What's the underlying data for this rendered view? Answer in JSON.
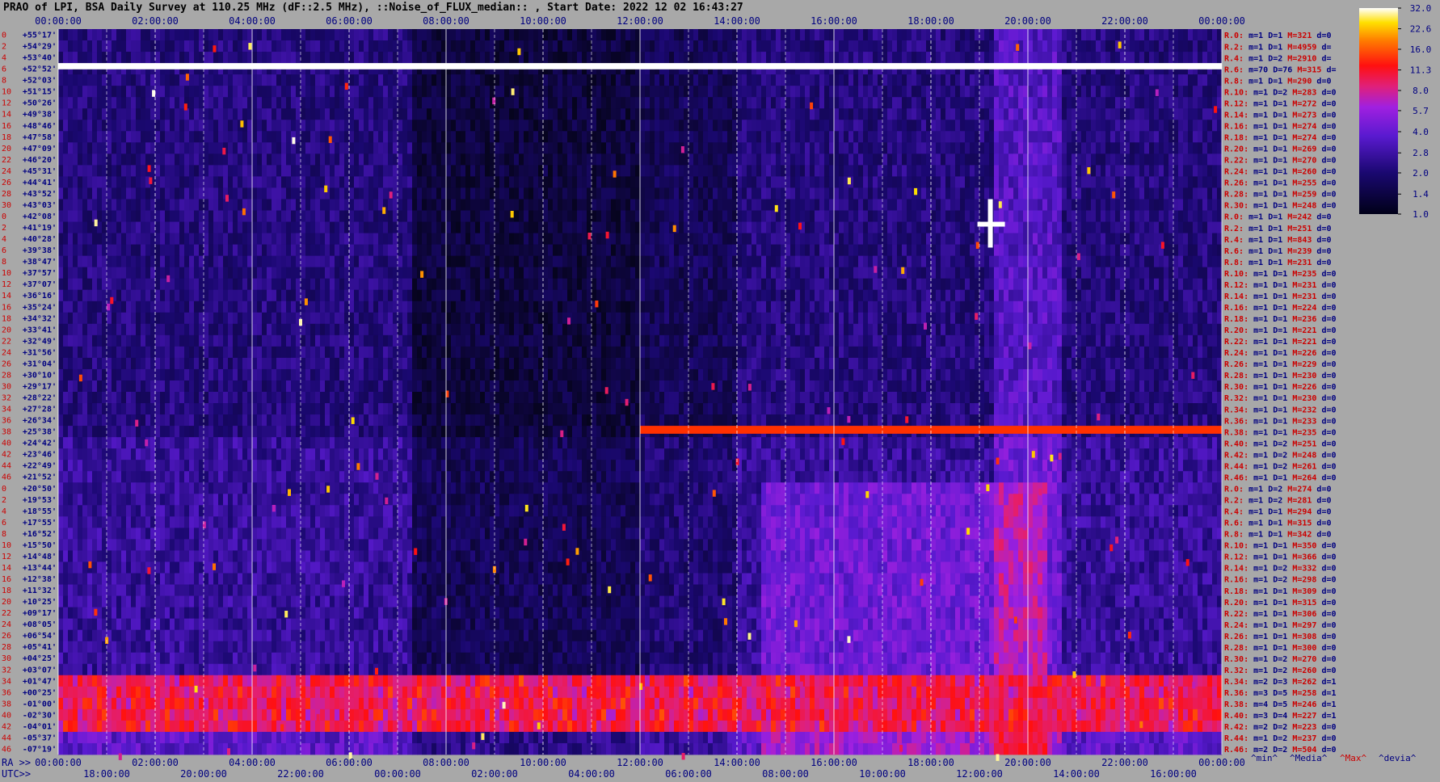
{
  "title": "PRAO of LPI, BSA Daily Survey at 110.25 MHz (dF::2.5 MHz), ::Noise_of_FLUX_median:: , Start Date: 2022 12 02 16:43:27",
  "chart_data": {
    "type": "heatmap",
    "title": "PRAO of LPI, BSA Daily Survey at 110.25 MHz (dF::2.5 MHz), ::Noise_of_FLUX_median:: , Start Date: 2022 12 02 16:43:27",
    "top_time_ticks": [
      "00:00:00",
      "02:00:00",
      "04:00:00",
      "06:00:00",
      "08:00:00",
      "10:00:00",
      "12:00:00",
      "14:00:00",
      "16:00:00",
      "18:00:00",
      "20:00:00",
      "22:00:00",
      "00:00:00"
    ],
    "ra_prefix": "RA >>",
    "ra_ticks": [
      "00:00:00",
      "02:00:00",
      "04:00:00",
      "06:00:00",
      "08:00:00",
      "10:00:00",
      "12:00:00",
      "14:00:00",
      "16:00:00",
      "18:00:00",
      "20:00:00",
      "22:00:00",
      "00:00:00"
    ],
    "utc_prefix": "UTC>>",
    "utc_ticks": [
      "18:00:00",
      "20:00:00",
      "22:00:00",
      "00:00:00",
      "02:00:00",
      "04:00:00",
      "06:00:00",
      "08:00:00",
      "10:00:00",
      "12:00:00",
      "14:00:00",
      "16:00:00"
    ],
    "declination_labels": [
      "+55°17'",
      "+54°29'",
      "+53°40'",
      "+52°52'",
      "+52°03'",
      "+51°15'",
      "+50°26'",
      "+49°38'",
      "+48°46'",
      "+47°58'",
      "+47°09'",
      "+46°20'",
      "+45°31'",
      "+44°41'",
      "+43°52'",
      "+43°03'",
      "+42°08'",
      "+41°19'",
      "+40°28'",
      "+39°38'",
      "+38°47'",
      "+37°57'",
      "+37°07'",
      "+36°16'",
      "+35°24'",
      "+34°32'",
      "+33°41'",
      "+32°49'",
      "+31°56'",
      "+31°04'",
      "+30°10'",
      "+29°17'",
      "+28°22'",
      "+27°28'",
      "+26°34'",
      "+25°38'",
      "+24°42'",
      "+23°46'",
      "+22°49'",
      "+21°52'",
      "+20°50'",
      "+19°53'",
      "+18°55'",
      "+17°55'",
      "+16°52'",
      "+15°50'",
      "+14°48'",
      "+13°44'",
      "+12°38'",
      "+11°32'",
      "+10°25'",
      "+09°17'",
      "+08°05'",
      "+06°54'",
      "+05°41'",
      "+04°25'",
      "+03°07'",
      "+01°47'",
      "+00°25'",
      "-01°00'",
      "-02°30'",
      "-04°01'",
      "-05°37'",
      "-07°19'"
    ],
    "row_index_labels": [
      "0",
      "2",
      "4",
      "6",
      "8",
      "10",
      "12",
      "14",
      "16",
      "18",
      "20",
      "22",
      "24",
      "26",
      "28",
      "30",
      "0",
      "2",
      "4",
      "6",
      "8",
      "10",
      "12",
      "14",
      "16",
      "18",
      "20",
      "22",
      "24",
      "26",
      "28",
      "30",
      "32",
      "34",
      "36",
      "38",
      "40",
      "42",
      "44",
      "46",
      "0",
      "2",
      "4",
      "6",
      "8",
      "10",
      "12",
      "14",
      "16",
      "18",
      "20",
      "22",
      "24",
      "26",
      "28",
      "30",
      "32",
      "34",
      "36",
      "38",
      "40",
      "42",
      "44",
      "46"
    ],
    "stats": [
      {
        "r": "R.0:",
        "m": "1",
        "d": "1",
        "mx": "321",
        "dv": "0"
      },
      {
        "r": "R.2:",
        "m": "1",
        "d": "1",
        "mx": "4959",
        "dv": ""
      },
      {
        "r": "R.4:",
        "m": "1",
        "d": "2",
        "mx": "2910",
        "dv": ""
      },
      {
        "r": "R.6:",
        "m": "70",
        "d": "76",
        "mx": "315",
        "dv": ""
      },
      {
        "r": "R.8:",
        "m": "1",
        "d": "1",
        "mx": "290",
        "dv": "0"
      },
      {
        "r": "R.10:",
        "m": "1",
        "d": "2",
        "mx": "283",
        "dv": "0"
      },
      {
        "r": "R.12:",
        "m": "1",
        "d": "1",
        "mx": "272",
        "dv": "0"
      },
      {
        "r": "R.14:",
        "m": "1",
        "d": "1",
        "mx": "273",
        "dv": "0"
      },
      {
        "r": "R.16:",
        "m": "1",
        "d": "1",
        "mx": "274",
        "dv": "0"
      },
      {
        "r": "R.18:",
        "m": "1",
        "d": "1",
        "mx": "274",
        "dv": "0"
      },
      {
        "r": "R.20:",
        "m": "1",
        "d": "1",
        "mx": "269",
        "dv": "0"
      },
      {
        "r": "R.22:",
        "m": "1",
        "d": "1",
        "mx": "270",
        "dv": "0"
      },
      {
        "r": "R.24:",
        "m": "1",
        "d": "1",
        "mx": "260",
        "dv": "0"
      },
      {
        "r": "R.26:",
        "m": "1",
        "d": "1",
        "mx": "255",
        "dv": "0"
      },
      {
        "r": "R.28:",
        "m": "1",
        "d": "1",
        "mx": "259",
        "dv": "0"
      },
      {
        "r": "R.30:",
        "m": "1",
        "d": "1",
        "mx": "248",
        "dv": "0"
      },
      {
        "r": "R.0:",
        "m": "1",
        "d": "1",
        "mx": "242",
        "dv": "0"
      },
      {
        "r": "R.2:",
        "m": "1",
        "d": "1",
        "mx": "251",
        "dv": "0"
      },
      {
        "r": "R.4:",
        "m": "1",
        "d": "1",
        "mx": "843",
        "dv": "0"
      },
      {
        "r": "R.6:",
        "m": "1",
        "d": "1",
        "mx": "239",
        "dv": "0"
      },
      {
        "r": "R.8:",
        "m": "1",
        "d": "1",
        "mx": "231",
        "dv": "0"
      },
      {
        "r": "R.10:",
        "m": "1",
        "d": "1",
        "mx": "235",
        "dv": "0"
      },
      {
        "r": "R.12:",
        "m": "1",
        "d": "1",
        "mx": "231",
        "dv": "0"
      },
      {
        "r": "R.14:",
        "m": "1",
        "d": "1",
        "mx": "231",
        "dv": "0"
      },
      {
        "r": "R.16:",
        "m": "1",
        "d": "1",
        "mx": "224",
        "dv": "0"
      },
      {
        "r": "R.18:",
        "m": "1",
        "d": "1",
        "mx": "236",
        "dv": "0"
      },
      {
        "r": "R.20:",
        "m": "1",
        "d": "1",
        "mx": "221",
        "dv": "0"
      },
      {
        "r": "R.22:",
        "m": "1",
        "d": "1",
        "mx": "221",
        "dv": "0"
      },
      {
        "r": "R.24:",
        "m": "1",
        "d": "1",
        "mx": "226",
        "dv": "0"
      },
      {
        "r": "R.26:",
        "m": "1",
        "d": "1",
        "mx": "229",
        "dv": "0"
      },
      {
        "r": "R.28:",
        "m": "1",
        "d": "1",
        "mx": "230",
        "dv": "0"
      },
      {
        "r": "R.30:",
        "m": "1",
        "d": "1",
        "mx": "226",
        "dv": "0"
      },
      {
        "r": "R.32:",
        "m": "1",
        "d": "1",
        "mx": "230",
        "dv": "0"
      },
      {
        "r": "R.34:",
        "m": "1",
        "d": "1",
        "mx": "232",
        "dv": "0"
      },
      {
        "r": "R.36:",
        "m": "1",
        "d": "1",
        "mx": "233",
        "dv": "0"
      },
      {
        "r": "R.38:",
        "m": "1",
        "d": "1",
        "mx": "235",
        "dv": "0"
      },
      {
        "r": "R.40:",
        "m": "1",
        "d": "2",
        "mx": "251",
        "dv": "0"
      },
      {
        "r": "R.42:",
        "m": "1",
        "d": "2",
        "mx": "248",
        "dv": "0"
      },
      {
        "r": "R.44:",
        "m": "1",
        "d": "2",
        "mx": "261",
        "dv": "0"
      },
      {
        "r": "R.46:",
        "m": "1",
        "d": "1",
        "mx": "264",
        "dv": "0"
      },
      {
        "r": "R.0:",
        "m": "1",
        "d": "2",
        "mx": "274",
        "dv": "0"
      },
      {
        "r": "R.2:",
        "m": "1",
        "d": "2",
        "mx": "281",
        "dv": "0"
      },
      {
        "r": "R.4:",
        "m": "1",
        "d": "1",
        "mx": "294",
        "dv": "0"
      },
      {
        "r": "R.6:",
        "m": "1",
        "d": "1",
        "mx": "315",
        "dv": "0"
      },
      {
        "r": "R.8:",
        "m": "1",
        "d": "1",
        "mx": "342",
        "dv": "0"
      },
      {
        "r": "R.10:",
        "m": "1",
        "d": "1",
        "mx": "350",
        "dv": "0"
      },
      {
        "r": "R.12:",
        "m": "1",
        "d": "1",
        "mx": "366",
        "dv": "0"
      },
      {
        "r": "R.14:",
        "m": "1",
        "d": "2",
        "mx": "332",
        "dv": "0"
      },
      {
        "r": "R.16:",
        "m": "1",
        "d": "2",
        "mx": "298",
        "dv": "0"
      },
      {
        "r": "R.18:",
        "m": "1",
        "d": "1",
        "mx": "309",
        "dv": "0"
      },
      {
        "r": "R.20:",
        "m": "1",
        "d": "1",
        "mx": "315",
        "dv": "0"
      },
      {
        "r": "R.22:",
        "m": "1",
        "d": "1",
        "mx": "306",
        "dv": "0"
      },
      {
        "r": "R.24:",
        "m": "1",
        "d": "1",
        "mx": "297",
        "dv": "0"
      },
      {
        "r": "R.26:",
        "m": "1",
        "d": "1",
        "mx": "308",
        "dv": "0"
      },
      {
        "r": "R.28:",
        "m": "1",
        "d": "1",
        "mx": "300",
        "dv": "0"
      },
      {
        "r": "R.30:",
        "m": "1",
        "d": "2",
        "mx": "270",
        "dv": "0"
      },
      {
        "r": "R.32:",
        "m": "1",
        "d": "2",
        "mx": "260",
        "dv": "0"
      },
      {
        "r": "R.34:",
        "m": "2",
        "d": "3",
        "mx": "262",
        "dv": "1"
      },
      {
        "r": "R.36:",
        "m": "3",
        "d": "5",
        "mx": "258",
        "dv": "1"
      },
      {
        "r": "R.38:",
        "m": "4",
        "d": "5",
        "mx": "246",
        "dv": "1"
      },
      {
        "r": "R.40:",
        "m": "3",
        "d": "4",
        "mx": "227",
        "dv": "1"
      },
      {
        "r": "R.42:",
        "m": "2",
        "d": "2",
        "mx": "223",
        "dv": "0"
      },
      {
        "r": "R.44:",
        "m": "1",
        "d": "2",
        "mx": "237",
        "dv": "0"
      },
      {
        "r": "R.46:",
        "m": "2",
        "d": "2",
        "mx": "504",
        "dv": "0"
      }
    ],
    "stat_keys": {
      "m": "m=",
      "d": "D=",
      "mx": "M=",
      "dv": "d="
    },
    "stat_footer": [
      "^min^",
      "^Media^",
      "^Max^",
      "^devia^"
    ],
    "colorbar_ticks": [
      "32.0",
      "22.6",
      "16.0",
      "11.3",
      "8.0",
      "5.7",
      "4.0",
      "2.8",
      "2.0",
      "1.4",
      "1.0"
    ],
    "colorbar_min": 1.0,
    "colorbar_max": 32.0,
    "colorbar_scale": "log",
    "colors": {
      "background": "#a8a8a8",
      "heatmap_low": "#000020",
      "heatmap_mid": "#6a1de0",
      "heatmap_high": "#ff2020",
      "heatmap_max": "#ffffff",
      "label_dark": "#000080",
      "label_red": "#cc0000"
    }
  }
}
